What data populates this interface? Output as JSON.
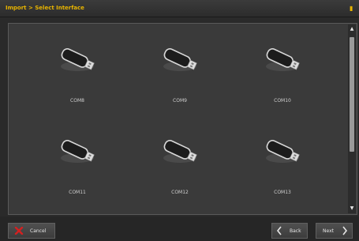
{
  "window": {
    "title": "Import > Select Interface",
    "title_icon": "info-icon"
  },
  "devices": [
    {
      "label": "COM8",
      "icon": "usb-drive-icon"
    },
    {
      "label": "COM9",
      "icon": "usb-drive-icon"
    },
    {
      "label": "COM10",
      "icon": "usb-drive-icon"
    },
    {
      "label": "COM11",
      "icon": "usb-drive-icon"
    },
    {
      "label": "COM12",
      "icon": "usb-drive-icon"
    },
    {
      "label": "COM13",
      "icon": "usb-drive-icon"
    }
  ],
  "footer": {
    "cancel_label": "Cancel",
    "back_label": "Back",
    "next_label": "Next"
  },
  "colors": {
    "accent": "#e8b400",
    "cancel_icon": "#d42020",
    "background": "#2a2a2a",
    "panel": "#3a3a3a"
  }
}
